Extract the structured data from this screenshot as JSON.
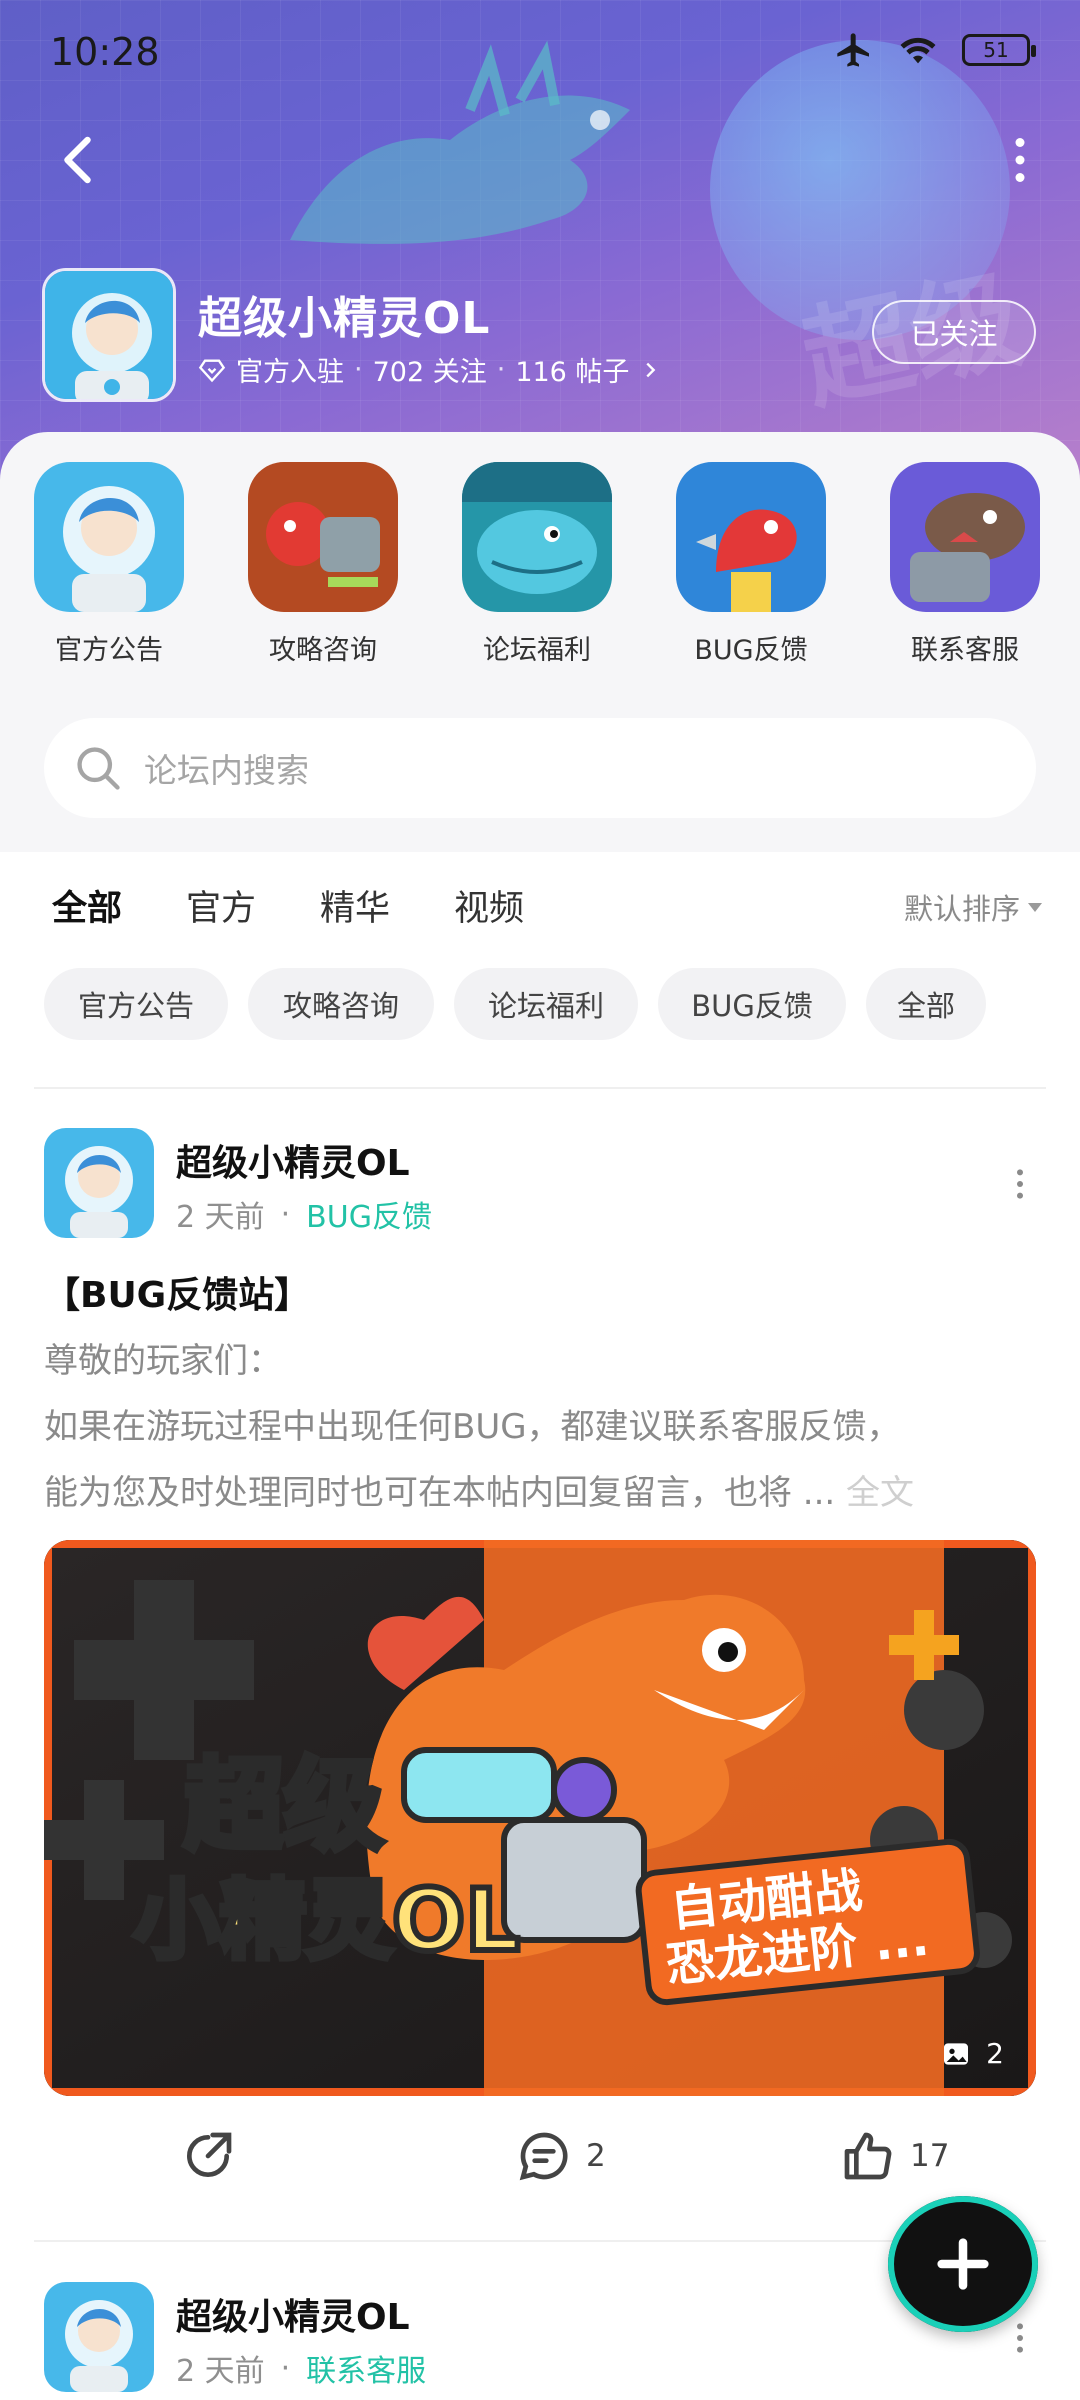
{
  "status_bar": {
    "time": "10:28",
    "battery": "51"
  },
  "forum": {
    "title": "超级小精灵OL",
    "verified_label": "官方入驻",
    "followers": "702 关注",
    "posts": "116 帖子",
    "follow_button": "已关注"
  },
  "boards": [
    {
      "label": "官方公告"
    },
    {
      "label": "攻略咨询"
    },
    {
      "label": "论坛福利"
    },
    {
      "label": "BUG反馈"
    },
    {
      "label": "联系客服"
    }
  ],
  "search": {
    "placeholder": "论坛内搜索"
  },
  "tabs": [
    {
      "label": "全部",
      "active": true
    },
    {
      "label": "官方"
    },
    {
      "label": "精华"
    },
    {
      "label": "视频"
    }
  ],
  "sort": {
    "label": "默认排序"
  },
  "chips": [
    "官方公告",
    "攻略咨询",
    "论坛福利",
    "BUG反馈",
    "全部"
  ],
  "posts": [
    {
      "author": "超级小精灵OL",
      "time": "2 天前",
      "tag": "BUG反馈",
      "title": "【BUG反馈站】",
      "line1": "尊敬的玩家们：",
      "line2": " 如果在游玩过程中出现任何BUG，都建议联系客服反馈，",
      "line3": "能为您及时处理同时也可在本帖内回复留言，也将 ...",
      "full_link": "全文",
      "image_text_1": "超级",
      "image_text_2": "小精灵OL",
      "image_text_3": "自动酣战",
      "image_text_4": "恐龙进阶 ...",
      "image_count": "2",
      "comments": "2",
      "likes": "17"
    },
    {
      "author": "超级小精灵OL",
      "time": "2 天前",
      "tag": "联系客服"
    }
  ],
  "colors": {
    "accent": "#22c2a6",
    "header_start": "#5f5fc7",
    "header_end": "#b77fcb"
  }
}
